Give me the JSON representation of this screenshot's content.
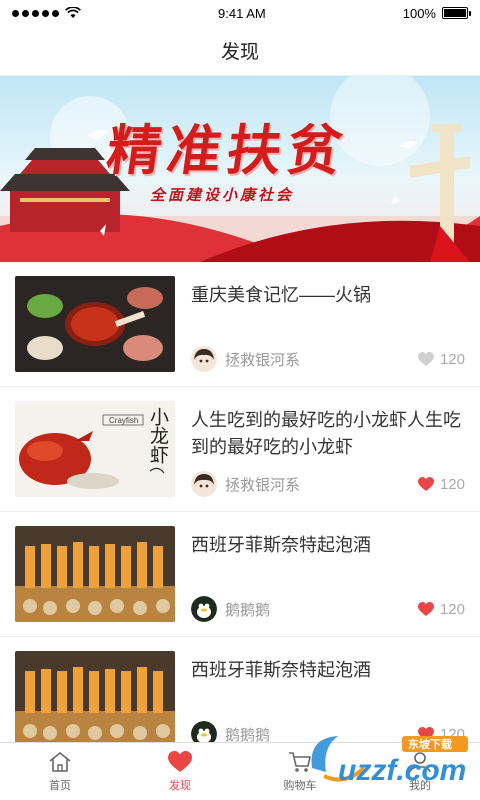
{
  "status": {
    "time": "9:41 AM",
    "battery": "100%"
  },
  "header": {
    "title": "发现"
  },
  "banner": {
    "title": "精准扶贫",
    "subtitle": "全面建设小康社会"
  },
  "articles": [
    {
      "title": "重庆美食记忆——火锅",
      "author": "拯救银河系",
      "likes": "120",
      "liked": false,
      "thumb_label": ""
    },
    {
      "title": "人生吃到的最好吃的小龙虾人生吃到的最好吃的小龙虾",
      "author": "拯救银河系",
      "likes": "120",
      "liked": true,
      "thumb_label": "小龙虾",
      "thumb_tag": "Crayfish"
    },
    {
      "title": "西班牙菲斯奈特起泡酒",
      "author": "鹅鹅鹅",
      "likes": "120",
      "liked": true,
      "thumb_label": ""
    },
    {
      "title": "西班牙菲斯奈特起泡酒",
      "author": "鹅鹅鹅",
      "likes": "120",
      "liked": true,
      "thumb_label": ""
    }
  ],
  "tabs": [
    {
      "label": "首页",
      "icon": "home-icon"
    },
    {
      "label": "发现",
      "icon": "heart-icon"
    },
    {
      "label": "购物车",
      "icon": "cart-icon"
    },
    {
      "label": "我的",
      "icon": "user-icon"
    }
  ],
  "watermark": {
    "text": "uzzf.com",
    "tag": "东坡下载"
  },
  "colors": {
    "accent": "#e94646",
    "liked": "#e94646",
    "unliked": "#cccccc"
  }
}
